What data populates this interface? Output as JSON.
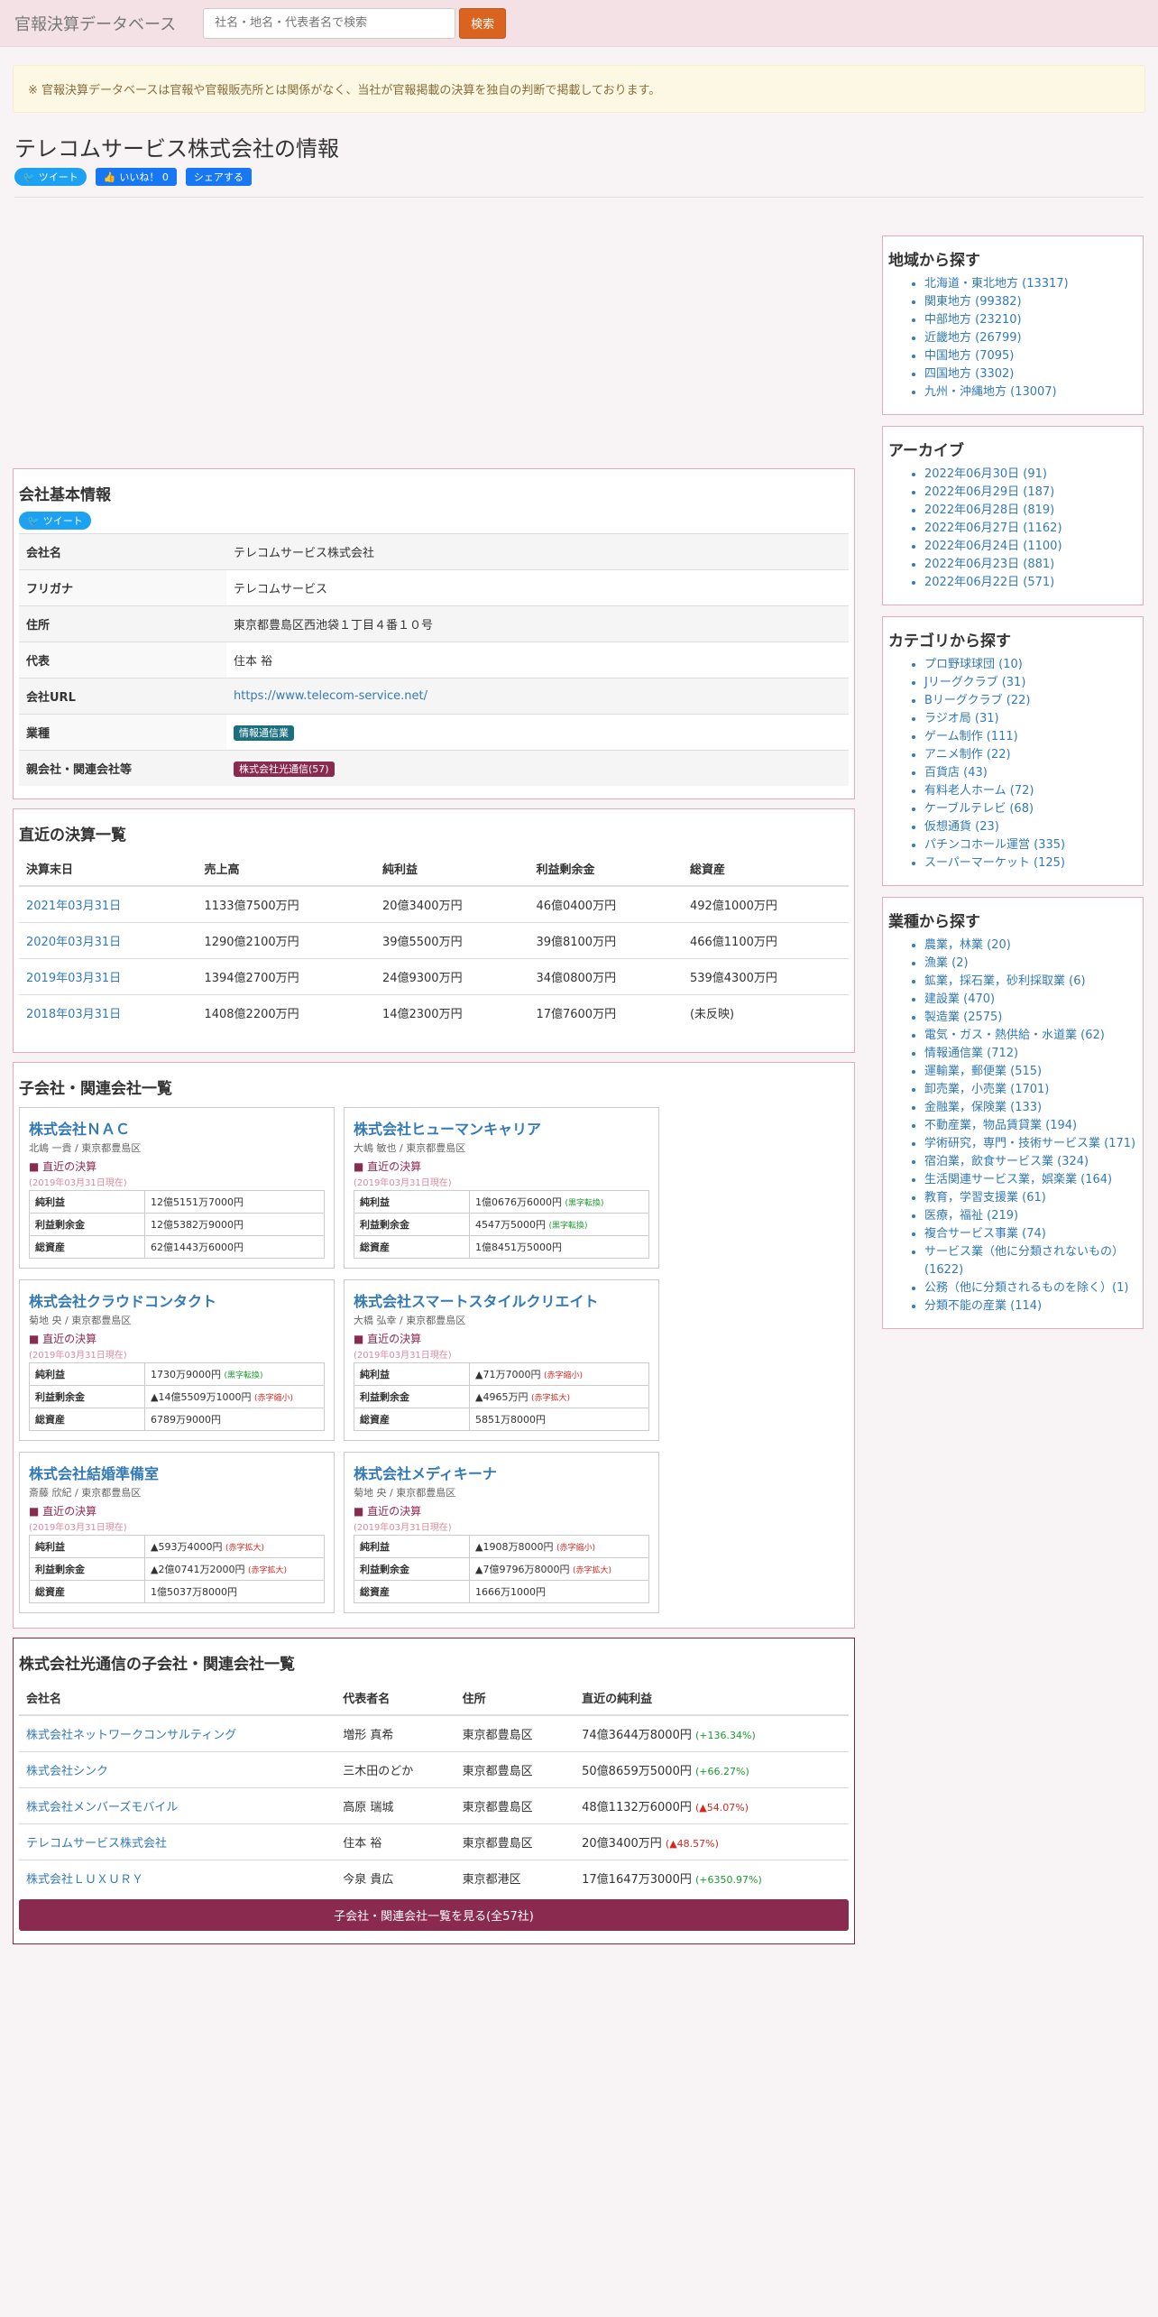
{
  "nav": {
    "brand": "官報決算データベース",
    "search_placeholder": "社名・地名・代表者名で検索",
    "search_button": "検索"
  },
  "notice": "※ 官報決算データベースは官報や官報販売所とは関係がなく、当社が官報掲載の決算を独自の判断で掲載しております。",
  "title": "テレコムサービス株式会社の情報",
  "social": {
    "tweet": "ツイート",
    "like": "いいね！ 0",
    "share": "シェアする"
  },
  "basic": {
    "heading": "会社基本情報",
    "tweet": "ツイート",
    "rows": [
      {
        "k": "会社名",
        "v": "テレコムサービス株式会社"
      },
      {
        "k": "フリガナ",
        "v": "テレコムサービス"
      },
      {
        "k": "住所",
        "v": "東京都豊島区西池袋１丁目４番１０号"
      },
      {
        "k": "代表",
        "v": "住本 裕"
      },
      {
        "k": "会社URL",
        "v": "https://www.telecom-service.net/"
      },
      {
        "k": "業種",
        "v": "情報通信業"
      },
      {
        "k": "親会社・関連会社等",
        "v": "株式会社光通信(57)"
      }
    ]
  },
  "results": {
    "heading": "直近の決算一覧",
    "headers": [
      "決算末日",
      "売上高",
      "純利益",
      "利益剰余金",
      "総資産"
    ],
    "rows": [
      [
        "2021年03月31日",
        "1133億7500万円",
        "20億3400万円",
        "46億0400万円",
        "492億1000万円"
      ],
      [
        "2020年03月31日",
        "1290億2100万円",
        "39億5500万円",
        "39億8100万円",
        "466億1100万円"
      ],
      [
        "2019年03月31日",
        "1394億2700万円",
        "24億9300万円",
        "34億0800万円",
        "539億4300万円"
      ],
      [
        "2018年03月31日",
        "1408億2200万円",
        "14億2300万円",
        "17億7600万円",
        "(未反映)"
      ]
    ]
  },
  "subs": {
    "heading": "子会社・関連会社一覧",
    "recent_label": "■ 直近の決算",
    "date_label": "(2019年03月31日現在)",
    "row_labels": [
      "純利益",
      "利益剰余金",
      "総資産"
    ],
    "cards": [
      {
        "name": "株式会社ＮＡＣ",
        "sub": "北嶋 一貴 / 東京都豊島区",
        "v1": "12億5151万7000円",
        "t1": "",
        "v2": "12億5382万9000円",
        "t2": "",
        "v3": "62億1443万6000円"
      },
      {
        "name": "株式会社ヒューマンキャリア",
        "sub": "大嶋 敏也 / 東京都豊島区",
        "v1": "1億0676万6000円",
        "t1": "(黒字転換)",
        "v2": "4547万5000円",
        "t2": "(黒字転換)",
        "v3": "1億8451万5000円"
      },
      {
        "name": "株式会社クラウドコンタクト",
        "sub": "菊地 央 / 東京都豊島区",
        "v1": "1730万9000円",
        "t1": "(黒字転換)",
        "v2": "▲14億5509万1000円",
        "t2": "(赤字縮小)",
        "v3": "6789万9000円"
      },
      {
        "name": "株式会社スマートスタイルクリエイト",
        "sub": "大橋 弘幸 / 東京都豊島区",
        "v1": "▲71万7000円",
        "t1": "(赤字縮小)",
        "v2": "▲4965万円",
        "t2": "(赤字拡大)",
        "v3": "5851万8000円"
      },
      {
        "name": "株式会社結婚準備室",
        "sub": "斎藤 欣紀 / 東京都豊島区",
        "v1": "▲593万4000円",
        "t1": "(赤字拡大)",
        "v2": "▲2億0741万2000円",
        "t2": "(赤字拡大)",
        "v3": "1億5037万8000円"
      },
      {
        "name": "株式会社メディキーナ",
        "sub": "菊地 央 / 東京都豊島区",
        "v1": "▲1908万8000円",
        "t1": "(赤字縮小)",
        "v2": "▲7億9796万8000円",
        "t2": "(赤字拡大)",
        "v3": "1666万1000円"
      }
    ]
  },
  "group": {
    "heading": "株式会社光通信の子会社・関連会社一覧",
    "headers": [
      "会社名",
      "代表者名",
      "住所",
      "直近の純利益"
    ],
    "rows": [
      {
        "name": "株式会社ネットワークコンサルティング",
        "rep": "増形 真希",
        "addr": "東京都豊島区",
        "profit": "74億3644万8000円",
        "pct": "(+136.34%)",
        "neg": false
      },
      {
        "name": "株式会社シンク",
        "rep": "三木田のどか",
        "addr": "東京都豊島区",
        "profit": "50億8659万5000円",
        "pct": "(+66.27%)",
        "neg": false
      },
      {
        "name": "株式会社メンバーズモバイル",
        "rep": "高原 瑞城",
        "addr": "東京都豊島区",
        "profit": "48億1132万6000円",
        "pct": "(▲54.07%)",
        "neg": true
      },
      {
        "name": "テレコムサービス株式会社",
        "rep": "住本 裕",
        "addr": "東京都豊島区",
        "profit": "20億3400万円",
        "pct": "(▲48.57%)",
        "neg": true
      },
      {
        "name": "株式会社ＬＵＸＵＲＹ",
        "rep": "今泉 貴広",
        "addr": "東京都港区",
        "profit": "17億1647万3000円",
        "pct": "(+6350.97%)",
        "neg": false
      }
    ],
    "more": "子会社・関連会社一覧を見る(全57社)"
  },
  "side": {
    "region": {
      "heading": "地域から探す",
      "items": [
        "北海道・東北地方 (13317)",
        "関東地方 (99382)",
        "中部地方 (23210)",
        "近畿地方 (26799)",
        "中国地方 (7095)",
        "四国地方 (3302)",
        "九州・沖縄地方 (13007)"
      ]
    },
    "archive": {
      "heading": "アーカイブ",
      "items": [
        "2022年06月30日 (91)",
        "2022年06月29日 (187)",
        "2022年06月28日 (819)",
        "2022年06月27日 (1162)",
        "2022年06月24日 (1100)",
        "2022年06月23日 (881)",
        "2022年06月22日 (571)"
      ]
    },
    "category": {
      "heading": "カテゴリから探す",
      "items": [
        "プロ野球球団 (10)",
        "Jリーグクラブ (31)",
        "Bリーグクラブ (22)",
        "ラジオ局 (31)",
        "ゲーム制作 (111)",
        "アニメ制作 (22)",
        "百貨店 (43)",
        "有料老人ホーム (72)",
        "ケーブルテレビ (68)",
        "仮想通貨 (23)",
        "パチンコホール運営 (335)",
        "スーパーマーケット (125)"
      ]
    },
    "industry": {
      "heading": "業種から探す",
      "items": [
        "農業，林業 (20)",
        "漁業 (2)",
        "鉱業，採石業，砂利採取業 (6)",
        "建設業 (470)",
        "製造業 (2575)",
        "電気・ガス・熱供給・水道業 (62)",
        "情報通信業 (712)",
        "運輸業，郵便業 (515)",
        "卸売業，小売業 (1701)",
        "金融業，保険業 (133)",
        "不動産業，物品賃貸業 (194)",
        "学術研究，専門・技術サービス業 (171)",
        "宿泊業，飲食サービス業 (324)",
        "生活関連サービス業，娯楽業 (164)",
        "教育，学習支援業 (61)",
        "医療，福祉 (219)",
        "複合サービス事業 (74)",
        "サービス業（他に分類されないもの）(1622)",
        "公務（他に分類されるものを除く）(1)",
        "分類不能の産業 (114)"
      ]
    }
  }
}
